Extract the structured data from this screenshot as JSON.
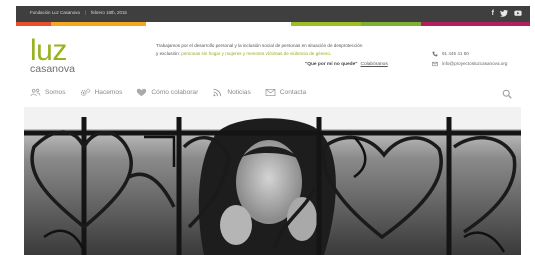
{
  "topbar": {
    "org": "Fundación Luz Casanova",
    "date": "febrero 18th, 2015",
    "social_icons": [
      "facebook-icon",
      "twitter-icon",
      "youtube-icon"
    ]
  },
  "colors": {
    "topbar_bg": "#3f3f3f",
    "strip": [
      "#e8502a",
      "#f5a623",
      "#ffffff",
      "#9dbf26",
      "#7fb032",
      "#b31e5c"
    ],
    "logo_green": "#94b31d",
    "nav_text": "#8a8a8a"
  },
  "logo": {
    "luz": "luz",
    "casanova": "casanova"
  },
  "tagline": {
    "line1": "Trabajamos por el desarrollo personal y la inclusión social de personas en situación de desprotección",
    "line2_start": "y exclusión: ",
    "line2_green": "personas sin hogar y mujeres y menores víctimas de violencia de género."
  },
  "quote": {
    "text": "\"Que por mí no quede\"",
    "link": "Colabóranos"
  },
  "contact": {
    "phone": "91 445 41 60",
    "email": "info@proyectosluzcasanova.org"
  },
  "nav": [
    {
      "label": "Somos",
      "icon": "people-icon"
    },
    {
      "label": "Hacemos",
      "icon": "gears-icon"
    },
    {
      "label": "Cómo colaborar",
      "icon": "heart-icon"
    },
    {
      "label": "Noticias",
      "icon": "rss-icon"
    },
    {
      "label": "Contacta",
      "icon": "envelope-icon"
    }
  ],
  "search_icon": "search-icon",
  "hero": {
    "alt": "photo-woman-behind-bars"
  }
}
